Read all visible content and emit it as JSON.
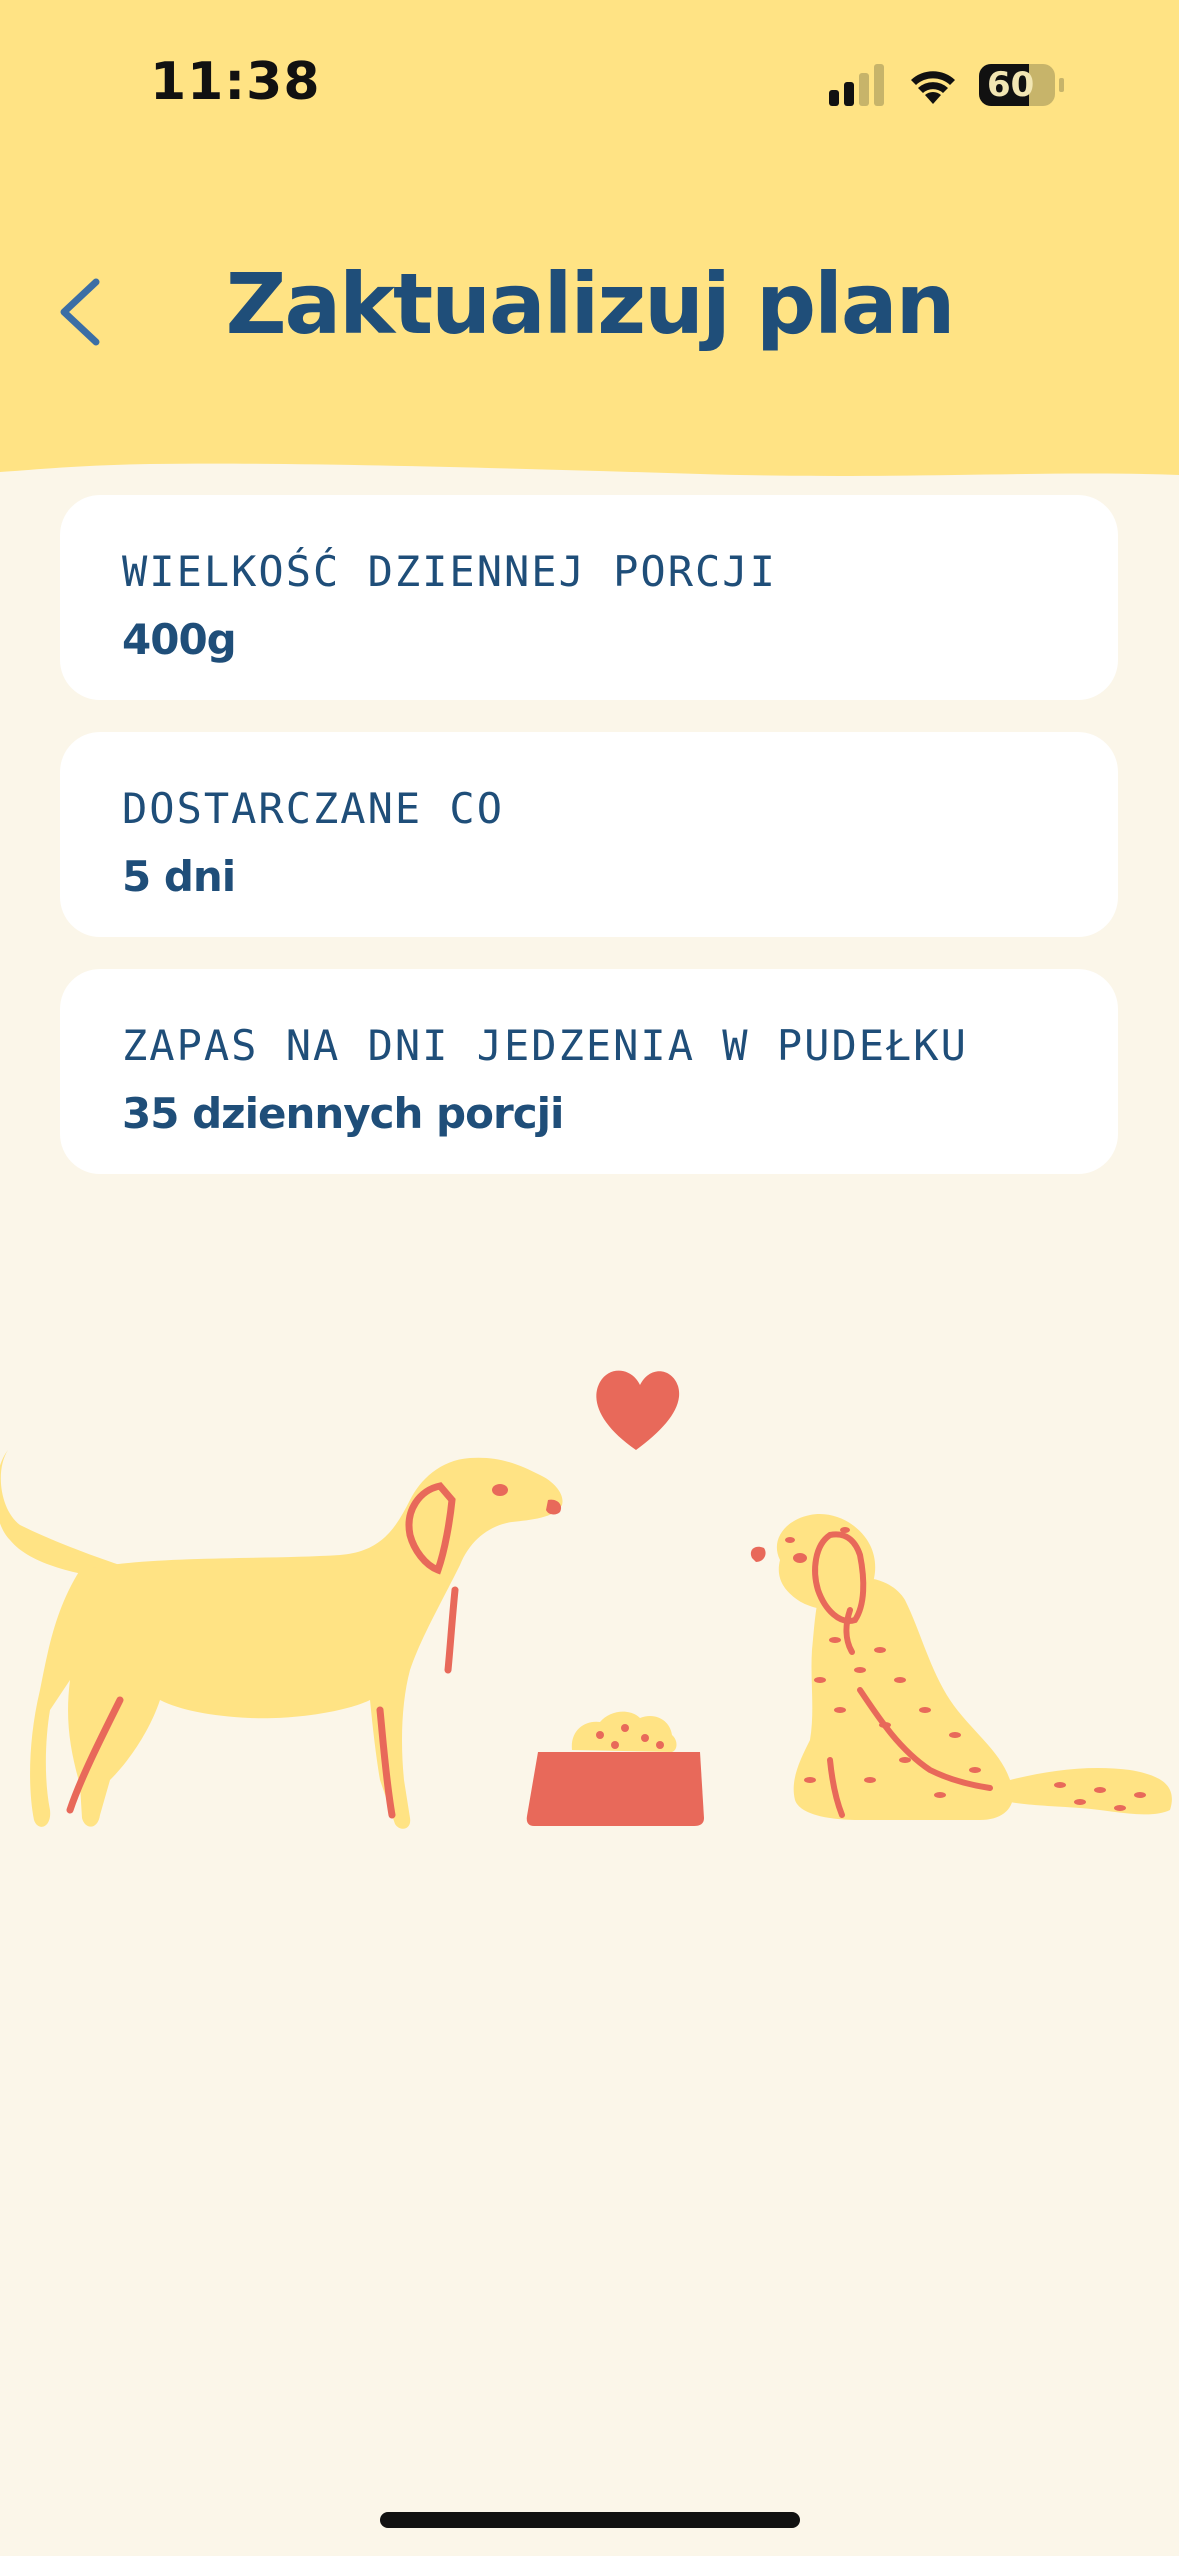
{
  "status_bar": {
    "time": "11:38",
    "battery_level": "60",
    "icons": [
      "cellular-signal-icon",
      "wifi-icon",
      "battery-icon"
    ]
  },
  "header": {
    "title": "Zaktualizuj plan",
    "back_icon": "chevron-left-icon"
  },
  "plan_cards": [
    {
      "label": "WIELKOŚĆ DZIENNEJ PORCJI",
      "value": "400g"
    },
    {
      "label": "DOSTARCZANE CO",
      "value": "5 dni"
    },
    {
      "label": "ZAPAS NA DNI JEDZENIA W PUDEŁKU",
      "value": "35 dziennych porcji"
    }
  ],
  "illustration": {
    "description_icons": [
      "dog-icon",
      "heart-icon",
      "food-bowl-icon",
      "poodle-icon"
    ]
  },
  "colors": {
    "header_bg": "#FFE384",
    "page_bg": "#FBF6E9",
    "primary_text": "#1F4E79",
    "accent_red": "#E8695A",
    "dog_yellow": "#FFE384"
  }
}
